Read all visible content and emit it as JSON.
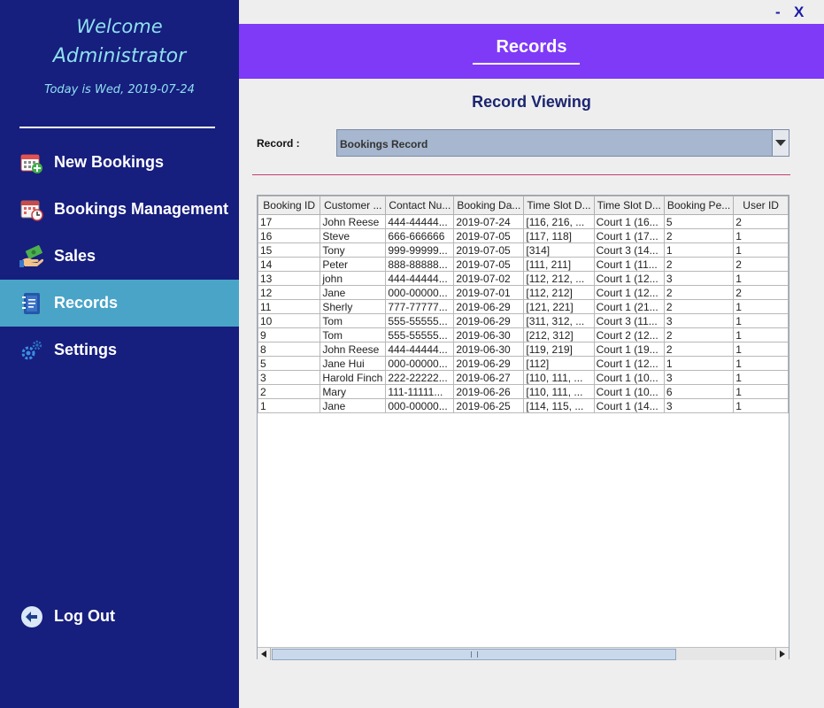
{
  "sidebar": {
    "welcome_line1": "Welcome",
    "welcome_line2": "Administrator",
    "date_text": "Today is Wed, 2019-07-24",
    "items": [
      {
        "label": "New Bookings",
        "icon": "calendar-add-icon",
        "active": false
      },
      {
        "label": "Bookings Management",
        "icon": "calendar-clock-icon",
        "active": false
      },
      {
        "label": "Sales",
        "icon": "money-hand-icon",
        "active": false
      },
      {
        "label": "Records",
        "icon": "notebook-icon",
        "active": true
      },
      {
        "label": "Settings",
        "icon": "gears-icon",
        "active": false
      }
    ],
    "logout_label": "Log Out"
  },
  "window": {
    "minimize_label": "-",
    "close_label": "X"
  },
  "header": {
    "title": "Records"
  },
  "main": {
    "subtitle": "Record Viewing",
    "record_label": "Record :",
    "record_select_value": "Bookings Record"
  },
  "table": {
    "columns": [
      "Booking ID",
      "Customer ...",
      "Contact Nu...",
      "Booking Da...",
      "Time Slot D...",
      "Time Slot D...",
      "Booking Pe...",
      "User ID"
    ],
    "rows": [
      [
        "17",
        "John Reese",
        "444-44444...",
        "2019-07-24",
        "[116, 216, ...",
        "Court 1 (16...",
        "5",
        "2"
      ],
      [
        "16",
        "Steve",
        "666-666666",
        "2019-07-05",
        "[117, 118]",
        "Court 1 (17...",
        "2",
        "1"
      ],
      [
        "15",
        "Tony",
        "999-99999...",
        "2019-07-05",
        "[314]",
        "Court 3 (14...",
        "1",
        "1"
      ],
      [
        "14",
        "Peter",
        "888-88888...",
        "2019-07-05",
        "[111, 211]",
        "Court 1 (11...",
        "2",
        "2"
      ],
      [
        "13",
        "john",
        "444-44444...",
        "2019-07-02",
        "[112, 212, ...",
        "Court 1 (12...",
        "3",
        "1"
      ],
      [
        "12",
        "Jane",
        "000-00000...",
        "2019-07-01",
        "[112, 212]",
        "Court 1 (12...",
        "2",
        "2"
      ],
      [
        "11",
        "Sherly",
        "777-77777...",
        "2019-06-29",
        "[121, 221]",
        "Court 1 (21...",
        "2",
        "1"
      ],
      [
        "10",
        "Tom",
        "555-55555...",
        "2019-06-29",
        "[311, 312, ...",
        "Court 3 (11...",
        "3",
        "1"
      ],
      [
        "9",
        "Tom",
        "555-55555...",
        "2019-06-30",
        "[212, 312]",
        "Court 2 (12...",
        "2",
        "1"
      ],
      [
        "8",
        "John Reese",
        "444-44444...",
        "2019-06-30",
        "[119, 219]",
        "Court 1 (19...",
        "2",
        "1"
      ],
      [
        "5",
        "Jane Hui",
        "000-00000...",
        "2019-06-29",
        "[112]",
        "Court 1 (12...",
        "1",
        "1"
      ],
      [
        "3",
        "Harold Finch",
        "222-22222...",
        "2019-06-27",
        "[110, 111, ...",
        "Court 1 (10...",
        "3",
        "1"
      ],
      [
        "2",
        "Mary",
        "111-11111...",
        "2019-06-26",
        "[110, 111, ...",
        "Court 1 (10...",
        "6",
        "1"
      ],
      [
        "1",
        "Jane",
        "000-00000...",
        "2019-06-25",
        "[114, 115, ...",
        "Court 1 (14...",
        "3",
        "1"
      ]
    ]
  },
  "colors": {
    "sidebar_bg": "#161e7e",
    "sidebar_active": "#4aa4c8",
    "header_bg": "#7f3af8",
    "welcome_text": "#8fe0ee",
    "subtitle_text": "#1b2570"
  }
}
